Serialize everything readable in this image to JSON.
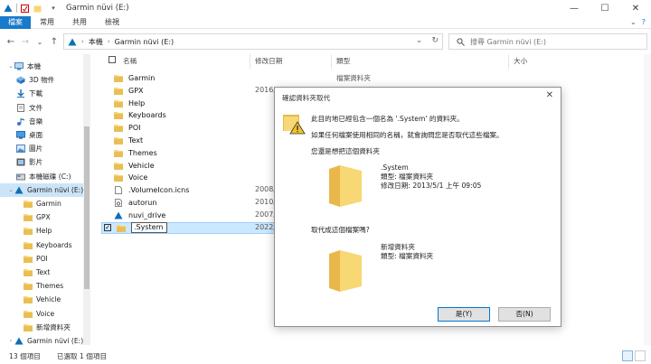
{
  "window": {
    "title": "Garmin nüvi (E:)",
    "min_glyph": "—",
    "max_glyph": "☐",
    "close_glyph": "✕"
  },
  "ribbon": {
    "tabs": [
      "檔案",
      "常用",
      "共用",
      "檢視"
    ],
    "expand_glyph": "⌄",
    "help_glyph": "?"
  },
  "nav_buttons": {
    "back": "←",
    "forward": "→",
    "recent": "⌄",
    "up": "↑"
  },
  "address": {
    "segments": [
      "本機",
      "Garmin nüvi (E:)"
    ],
    "dropdown_glyph": "⌄",
    "refresh_glyph": "↻"
  },
  "search": {
    "placeholder": "搜尋 Garmin nüvi (E:)"
  },
  "sidebar": {
    "items": [
      {
        "label": "本機",
        "icon": "computer-icon",
        "chevron": "⌄"
      },
      {
        "label": "3D 物件",
        "icon": "3d-objects-icon",
        "chevron": ""
      },
      {
        "label": "下載",
        "icon": "downloads-icon",
        "chevron": ""
      },
      {
        "label": "文件",
        "icon": "documents-icon",
        "chevron": ""
      },
      {
        "label": "音樂",
        "icon": "music-icon",
        "chevron": ""
      },
      {
        "label": "桌面",
        "icon": "desktop-icon",
        "chevron": ""
      },
      {
        "label": "圖片",
        "icon": "pictures-icon",
        "chevron": ""
      },
      {
        "label": "影片",
        "icon": "videos-icon",
        "chevron": ""
      },
      {
        "label": "本機磁碟 (C:)",
        "icon": "drive-icon",
        "chevron": ""
      },
      {
        "label": "Garmin nüvi (E:)",
        "icon": "garmin-drive-icon",
        "chevron": "⌄"
      },
      {
        "label": "Garmin",
        "icon": "folder-icon",
        "chevron": ""
      },
      {
        "label": "GPX",
        "icon": "folder-icon",
        "chevron": ""
      },
      {
        "label": "Help",
        "icon": "folder-icon",
        "chevron": ""
      },
      {
        "label": "Keyboards",
        "icon": "folder-icon",
        "chevron": ""
      },
      {
        "label": "POI",
        "icon": "folder-icon",
        "chevron": ""
      },
      {
        "label": "Text",
        "icon": "folder-icon",
        "chevron": ""
      },
      {
        "label": "Themes",
        "icon": "folder-icon",
        "chevron": ""
      },
      {
        "label": "Vehicle",
        "icon": "folder-icon",
        "chevron": ""
      },
      {
        "label": "Voice",
        "icon": "folder-icon",
        "chevron": ""
      },
      {
        "label": "新增資料夾",
        "icon": "folder-icon",
        "chevron": ""
      },
      {
        "label": "Garmin nüvi (E:)",
        "icon": "garmin-drive-icon",
        "chevron": "›"
      }
    ]
  },
  "columns": {
    "name": "名稱",
    "date": "修改日期",
    "type": "類型",
    "size": "大小"
  },
  "files": [
    {
      "name": "Garmin",
      "date": "",
      "type": "檔案資料夾",
      "icon": "folder-icon"
    },
    {
      "name": "GPX",
      "date": "2016/5/...",
      "type": "",
      "icon": "folder-icon"
    },
    {
      "name": "Help",
      "date": "",
      "type": "",
      "icon": "folder-icon"
    },
    {
      "name": "Keyboards",
      "date": "",
      "type": "",
      "icon": "folder-icon"
    },
    {
      "name": "POI",
      "date": "",
      "type": "",
      "icon": "folder-icon"
    },
    {
      "name": "Text",
      "date": "",
      "type": "",
      "icon": "folder-icon"
    },
    {
      "name": "Themes",
      "date": "",
      "type": "",
      "icon": "folder-icon"
    },
    {
      "name": "Vehicle",
      "date": "",
      "type": "",
      "icon": "folder-icon"
    },
    {
      "name": "Voice",
      "date": "",
      "type": "",
      "icon": "folder-icon"
    },
    {
      "name": ".VolumeIcon.icns",
      "date": "2008/5",
      "type": "",
      "icon": "file-icon"
    },
    {
      "name": "autorun",
      "date": "2010/8",
      "type": "",
      "icon": "settings-file-icon"
    },
    {
      "name": "nuvi_drive",
      "date": "2007/9",
      "type": "",
      "icon": "garmin-icon"
    },
    {
      "name": ".System",
      "date": "2022/9",
      "type": "",
      "icon": "folder-icon",
      "selected": true,
      "checkbox": "✓"
    }
  ],
  "status": {
    "count": "13 個項目",
    "selected": "已選取 1 個項目"
  },
  "dialog": {
    "title": "確認資料夾取代",
    "close_glyph": "✕",
    "message1": "此目的地已經包含一個名為 '.System' 的資料夾。",
    "message2": "如果任何檔案使用相同的名稱，就會詢問您是否取代這些檔案。",
    "question1": "您還是想把這個資料夾",
    "existing": {
      "name": ".System",
      "type": "類型: 檔案資料夾",
      "modified": "修改日期: 2013/5/1 上午 09:05"
    },
    "question2": "取代成這個檔案嗎?",
    "new": {
      "name": "新增資料夾",
      "type": "類型: 檔案資料夾"
    },
    "yes_button": "是(Y)",
    "no_button": "否(N)"
  },
  "colors": {
    "accent": "#1979ca",
    "folder": "#f8d775",
    "folder_dark": "#e8b84a",
    "selection": "#cce8ff"
  }
}
